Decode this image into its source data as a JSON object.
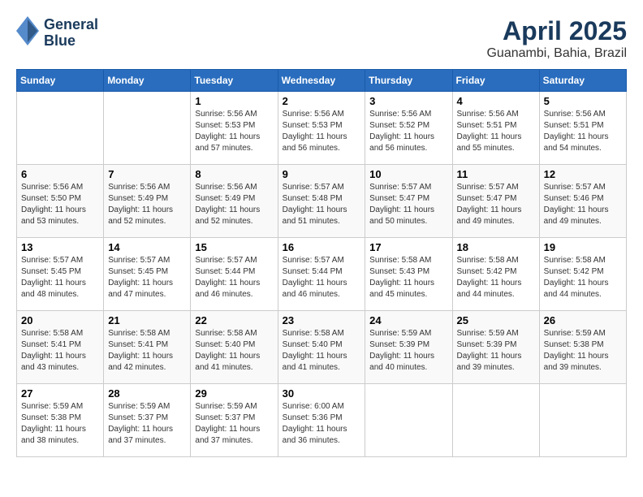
{
  "header": {
    "logo_line1": "General",
    "logo_line2": "Blue",
    "title": "April 2025",
    "subtitle": "Guanambi, Bahia, Brazil"
  },
  "weekdays": [
    "Sunday",
    "Monday",
    "Tuesday",
    "Wednesday",
    "Thursday",
    "Friday",
    "Saturday"
  ],
  "weeks": [
    [
      {
        "day": "",
        "info": ""
      },
      {
        "day": "",
        "info": ""
      },
      {
        "day": "1",
        "info": "Sunrise: 5:56 AM\nSunset: 5:53 PM\nDaylight: 11 hours and 57 minutes."
      },
      {
        "day": "2",
        "info": "Sunrise: 5:56 AM\nSunset: 5:53 PM\nDaylight: 11 hours and 56 minutes."
      },
      {
        "day": "3",
        "info": "Sunrise: 5:56 AM\nSunset: 5:52 PM\nDaylight: 11 hours and 56 minutes."
      },
      {
        "day": "4",
        "info": "Sunrise: 5:56 AM\nSunset: 5:51 PM\nDaylight: 11 hours and 55 minutes."
      },
      {
        "day": "5",
        "info": "Sunrise: 5:56 AM\nSunset: 5:51 PM\nDaylight: 11 hours and 54 minutes."
      }
    ],
    [
      {
        "day": "6",
        "info": "Sunrise: 5:56 AM\nSunset: 5:50 PM\nDaylight: 11 hours and 53 minutes."
      },
      {
        "day": "7",
        "info": "Sunrise: 5:56 AM\nSunset: 5:49 PM\nDaylight: 11 hours and 52 minutes."
      },
      {
        "day": "8",
        "info": "Sunrise: 5:56 AM\nSunset: 5:49 PM\nDaylight: 11 hours and 52 minutes."
      },
      {
        "day": "9",
        "info": "Sunrise: 5:57 AM\nSunset: 5:48 PM\nDaylight: 11 hours and 51 minutes."
      },
      {
        "day": "10",
        "info": "Sunrise: 5:57 AM\nSunset: 5:47 PM\nDaylight: 11 hours and 50 minutes."
      },
      {
        "day": "11",
        "info": "Sunrise: 5:57 AM\nSunset: 5:47 PM\nDaylight: 11 hours and 49 minutes."
      },
      {
        "day": "12",
        "info": "Sunrise: 5:57 AM\nSunset: 5:46 PM\nDaylight: 11 hours and 49 minutes."
      }
    ],
    [
      {
        "day": "13",
        "info": "Sunrise: 5:57 AM\nSunset: 5:45 PM\nDaylight: 11 hours and 48 minutes."
      },
      {
        "day": "14",
        "info": "Sunrise: 5:57 AM\nSunset: 5:45 PM\nDaylight: 11 hours and 47 minutes."
      },
      {
        "day": "15",
        "info": "Sunrise: 5:57 AM\nSunset: 5:44 PM\nDaylight: 11 hours and 46 minutes."
      },
      {
        "day": "16",
        "info": "Sunrise: 5:57 AM\nSunset: 5:44 PM\nDaylight: 11 hours and 46 minutes."
      },
      {
        "day": "17",
        "info": "Sunrise: 5:58 AM\nSunset: 5:43 PM\nDaylight: 11 hours and 45 minutes."
      },
      {
        "day": "18",
        "info": "Sunrise: 5:58 AM\nSunset: 5:42 PM\nDaylight: 11 hours and 44 minutes."
      },
      {
        "day": "19",
        "info": "Sunrise: 5:58 AM\nSunset: 5:42 PM\nDaylight: 11 hours and 44 minutes."
      }
    ],
    [
      {
        "day": "20",
        "info": "Sunrise: 5:58 AM\nSunset: 5:41 PM\nDaylight: 11 hours and 43 minutes."
      },
      {
        "day": "21",
        "info": "Sunrise: 5:58 AM\nSunset: 5:41 PM\nDaylight: 11 hours and 42 minutes."
      },
      {
        "day": "22",
        "info": "Sunrise: 5:58 AM\nSunset: 5:40 PM\nDaylight: 11 hours and 41 minutes."
      },
      {
        "day": "23",
        "info": "Sunrise: 5:58 AM\nSunset: 5:40 PM\nDaylight: 11 hours and 41 minutes."
      },
      {
        "day": "24",
        "info": "Sunrise: 5:59 AM\nSunset: 5:39 PM\nDaylight: 11 hours and 40 minutes."
      },
      {
        "day": "25",
        "info": "Sunrise: 5:59 AM\nSunset: 5:39 PM\nDaylight: 11 hours and 39 minutes."
      },
      {
        "day": "26",
        "info": "Sunrise: 5:59 AM\nSunset: 5:38 PM\nDaylight: 11 hours and 39 minutes."
      }
    ],
    [
      {
        "day": "27",
        "info": "Sunrise: 5:59 AM\nSunset: 5:38 PM\nDaylight: 11 hours and 38 minutes."
      },
      {
        "day": "28",
        "info": "Sunrise: 5:59 AM\nSunset: 5:37 PM\nDaylight: 11 hours and 37 minutes."
      },
      {
        "day": "29",
        "info": "Sunrise: 5:59 AM\nSunset: 5:37 PM\nDaylight: 11 hours and 37 minutes."
      },
      {
        "day": "30",
        "info": "Sunrise: 6:00 AM\nSunset: 5:36 PM\nDaylight: 11 hours and 36 minutes."
      },
      {
        "day": "",
        "info": ""
      },
      {
        "day": "",
        "info": ""
      },
      {
        "day": "",
        "info": ""
      }
    ]
  ]
}
